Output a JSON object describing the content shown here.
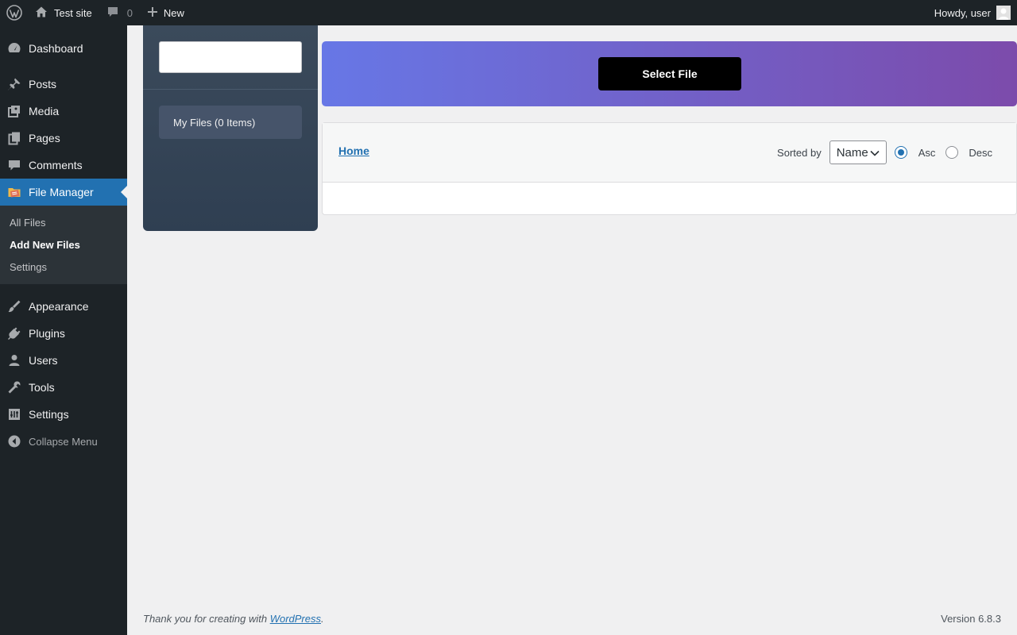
{
  "admin_bar": {
    "site_name": "Test site",
    "comments_count": "0",
    "new_label": "New",
    "greeting": "Howdy, user"
  },
  "sidebar": {
    "items": [
      {
        "label": "Dashboard",
        "icon": "dashboard-icon"
      },
      {
        "label": "Posts",
        "icon": "pushpin-icon"
      },
      {
        "label": "Media",
        "icon": "media-icon"
      },
      {
        "label": "Pages",
        "icon": "pages-icon"
      },
      {
        "label": "Comments",
        "icon": "comment-icon"
      },
      {
        "label": "File Manager",
        "icon": "file-manager-icon"
      }
    ],
    "submenu": [
      {
        "label": "All Files"
      },
      {
        "label": "Add New Files"
      },
      {
        "label": "Settings"
      }
    ],
    "items_after": [
      {
        "label": "Appearance",
        "icon": "brush-icon"
      },
      {
        "label": "Plugins",
        "icon": "plugin-icon"
      },
      {
        "label": "Users",
        "icon": "users-icon"
      },
      {
        "label": "Tools",
        "icon": "wrench-icon"
      },
      {
        "label": "Settings",
        "icon": "settings-icon"
      }
    ],
    "collapse_label": "Collapse Menu"
  },
  "file_manager": {
    "search_value": "",
    "my_files_label": "My Files (0 Items)",
    "select_file_label": "Select File",
    "breadcrumb_home": "Home",
    "sorted_by_label": "Sorted by",
    "sort_selected": "Name",
    "sort_order": {
      "asc_label": "Asc",
      "desc_label": "Desc",
      "selected": "Asc"
    }
  },
  "footer": {
    "thanks_prefix": "Thank you for creating with ",
    "thanks_link": "WordPress",
    "thanks_suffix": ".",
    "version": "Version 6.8.3"
  },
  "colors": {
    "admin_dark": "#1d2327",
    "accent": "#2271b1",
    "header_gradient_start": "#6777e6",
    "header_gradient_end": "#7c4bab"
  }
}
